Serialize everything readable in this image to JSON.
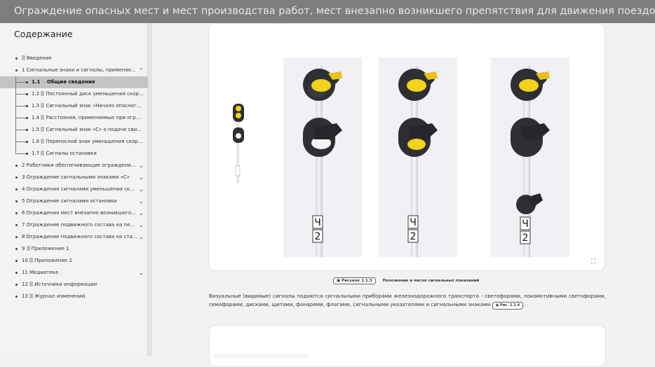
{
  "title": "Ограждение опасных мест и мест производства работ, мест внезапно возникшего препятствия для движения поездов",
  "toc": {
    "heading": "Содержание",
    "items": [
      {
        "label": "Введение",
        "doc": true,
        "chevron": ""
      },
      {
        "label": "1 Сигнальные знаки и сигналы, применяем...",
        "doc": false,
        "chevron": "^"
      },
      {
        "label": "1.1 Общие сведения",
        "doc": true,
        "sub": true,
        "active": true
      },
      {
        "label": "1.2 Постоянный диск уменьшения скоро...",
        "doc": true,
        "sub": true
      },
      {
        "label": "1.3 Сигнальный знак «Начало опасного ...",
        "doc": true,
        "sub": true
      },
      {
        "label": "1.4 Расстояния, применяемые при ограж...",
        "doc": true,
        "sub": true
      },
      {
        "label": "1.5 Сигнальный знак «С» о подаче свист...",
        "doc": true,
        "sub": true
      },
      {
        "label": "1.6 Переносной знак уменьшения скорос...",
        "doc": true,
        "sub": true
      },
      {
        "label": "1.7 Сигналы остановки",
        "doc": true,
        "sub": true,
        "last": true
      },
      {
        "label": "2 Работники обеспечивающие ограждение о...",
        "doc": false,
        "chevron": "v"
      },
      {
        "label": "3 Ограждение сигнальными знаками «С»",
        "doc": false,
        "chevron": "v"
      },
      {
        "label": "4 Ограждения сигналами уменьшения скоро...",
        "doc": false,
        "chevron": "v"
      },
      {
        "label": "5 Ограждение сигналами остановки",
        "doc": false,
        "chevron": "v"
      },
      {
        "label": "6 Ограждения мест внезапно возникшего п...",
        "doc": false,
        "chevron": "v"
      },
      {
        "label": "7 Ограждение подвижного состава на перег...",
        "doc": false,
        "chevron": "v"
      },
      {
        "label": "8 Ограждение подвижного состава на станц...",
        "doc": false,
        "chevron": "v"
      },
      {
        "label": "9 Приложение 1",
        "doc": true,
        "chevron": ""
      },
      {
        "label": "10 Приложение 2",
        "doc": true,
        "chevron": ""
      },
      {
        "label": "11 Медиатека",
        "doc": false,
        "chevron": "v"
      },
      {
        "label": "12 Источники информации",
        "doc": true,
        "chevron": ""
      },
      {
        "label": "13 Журнал изменений",
        "doc": true,
        "chevron": ""
      }
    ]
  },
  "figure": {
    "badge": "Рисунок 1.1.3",
    "caption": "Положение и число сигнальных показаний",
    "post_marks": [
      "Ч",
      "2"
    ],
    "expand_icon": "fullscreen-icon"
  },
  "paragraph": {
    "text": "Визуальные (видимые) сигналы подаются сигнальными приборами железнодорожного транспорта - светофорами, локомотивными светофорами, семафорами, дисками, щитами, фонарями, флагами, сигнальными указателями и сигнальными знаками",
    "badge": "Рис. 1.1.4",
    "tail": "."
  },
  "colors": {
    "titlebar": "#7d7d7d",
    "signal_yellow": "#f2d21a",
    "signal_white": "#f4f4f4",
    "head": "#2e2f33"
  }
}
